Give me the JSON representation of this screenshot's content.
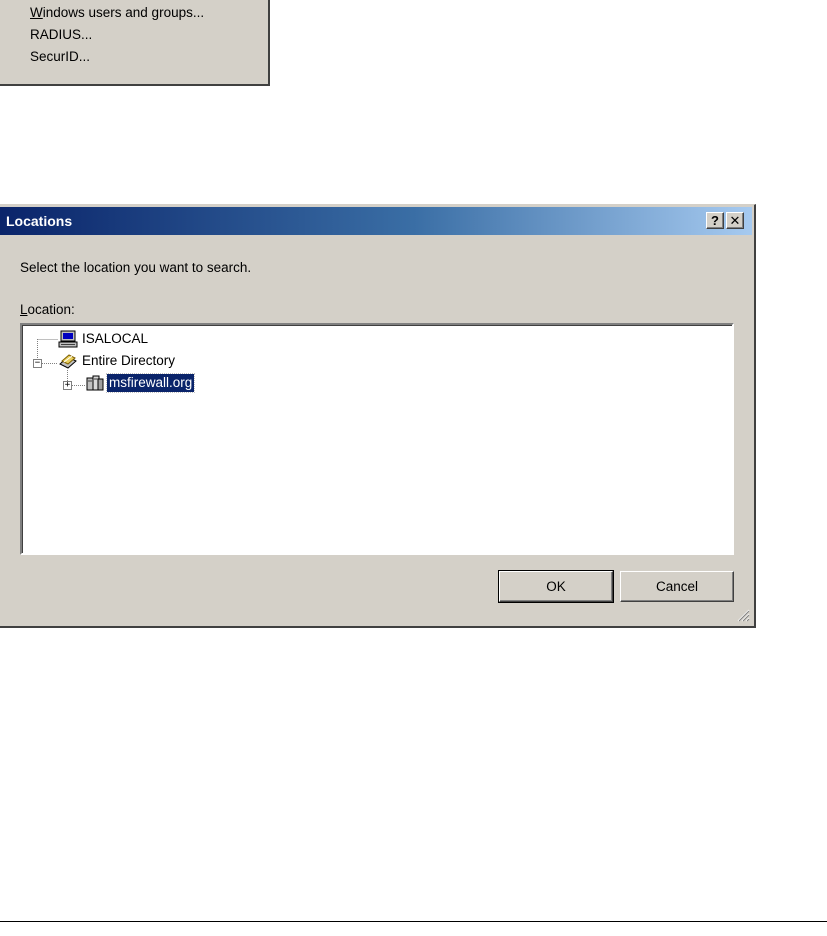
{
  "menu": {
    "items": [
      {
        "label": "Windows users and groups...",
        "accel": "W",
        "rest": "indows users and groups..."
      },
      {
        "label": "RADIUS..."
      },
      {
        "label": "SecurID..."
      }
    ]
  },
  "dialog": {
    "title": "Locations",
    "help_glyph": "?",
    "close_glyph": "✕",
    "instruction": "Select the location you want to search.",
    "location_label": {
      "accel": "L",
      "rest": "ocation:"
    },
    "tree": [
      {
        "label": "ISALOCAL",
        "icon": "computer-icon"
      },
      {
        "label": "Entire Directory",
        "icon": "directory-icon",
        "expander": "−"
      },
      {
        "label": "msfirewall.org",
        "icon": "domain-icon",
        "expander": "+",
        "selected": true
      }
    ],
    "ok_label": "OK",
    "cancel_label": "Cancel"
  },
  "colors": {
    "face": "#d4d0c8",
    "title_start": "#0a246a",
    "title_end": "#a6caf0",
    "selection": "#0a246a"
  }
}
